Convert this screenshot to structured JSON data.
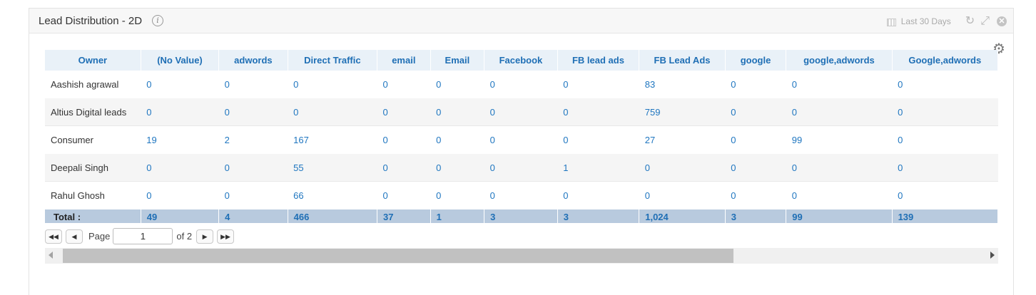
{
  "widget": {
    "title": "Lead Distribution - 2D",
    "info_icon": "info-icon",
    "date_range": "Last 30 Days",
    "icons": [
      "calendar-icon",
      "refresh-icon",
      "expand-icon",
      "close-icon",
      "gear-icon"
    ]
  },
  "table": {
    "columns": [
      "Owner",
      "(No Value)",
      "adwords",
      "Direct Traffic",
      "email",
      "Email",
      "Facebook",
      "FB lead ads",
      "FB Lead Ads",
      "google",
      "google,adwords",
      "Google,adwords"
    ],
    "rows": [
      [
        "Aashish agrawal",
        "0",
        "0",
        "0",
        "0",
        "0",
        "0",
        "0",
        "83",
        "0",
        "0",
        "0"
      ],
      [
        "Altius Digital leads",
        "0",
        "0",
        "0",
        "0",
        "0",
        "0",
        "0",
        "759",
        "0",
        "0",
        "0"
      ],
      [
        "Consumer",
        "19",
        "2",
        "167",
        "0",
        "0",
        "0",
        "0",
        "27",
        "0",
        "99",
        "0"
      ],
      [
        "Deepali Singh",
        "0",
        "0",
        "55",
        "0",
        "0",
        "0",
        "1",
        "0",
        "0",
        "0",
        "0"
      ],
      [
        "Rahul Ghosh",
        "0",
        "0",
        "66",
        "0",
        "0",
        "0",
        "0",
        "0",
        "0",
        "0",
        "0"
      ]
    ],
    "totals": [
      "Total :",
      "49",
      "4",
      "466",
      "37",
      "1",
      "3",
      "3",
      "1,024",
      "3",
      "99",
      "139"
    ]
  },
  "pager": {
    "page_label": "Page",
    "current_page": "1",
    "of_label": "of 2"
  },
  "colors": {
    "header_bg": "#e9f1f8",
    "header_text": "#1f6fb5",
    "value_text": "#1f76c0",
    "total_bg": "#b8cade"
  }
}
